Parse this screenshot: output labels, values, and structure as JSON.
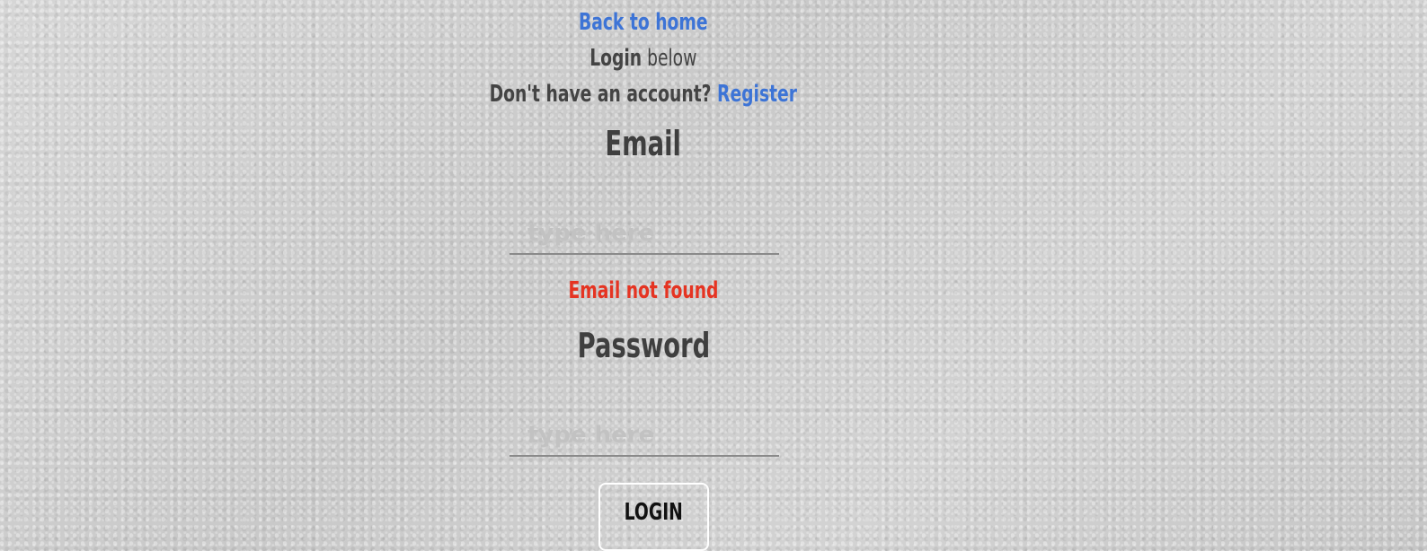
{
  "header": {
    "back_link": "Back to home",
    "login_bold": "Login",
    "login_rest": " below",
    "no_account_text": "Don't have an account? ",
    "register_link": "Register"
  },
  "form": {
    "email_label": "Email",
    "email_placeholder": "type here",
    "email_error": "Email not found",
    "password_label": "Password",
    "password_placeholder": "type here",
    "login_button": "LOGIN"
  },
  "colors": {
    "link": "#3d74d6",
    "error": "#e53422",
    "text": "#444444"
  }
}
